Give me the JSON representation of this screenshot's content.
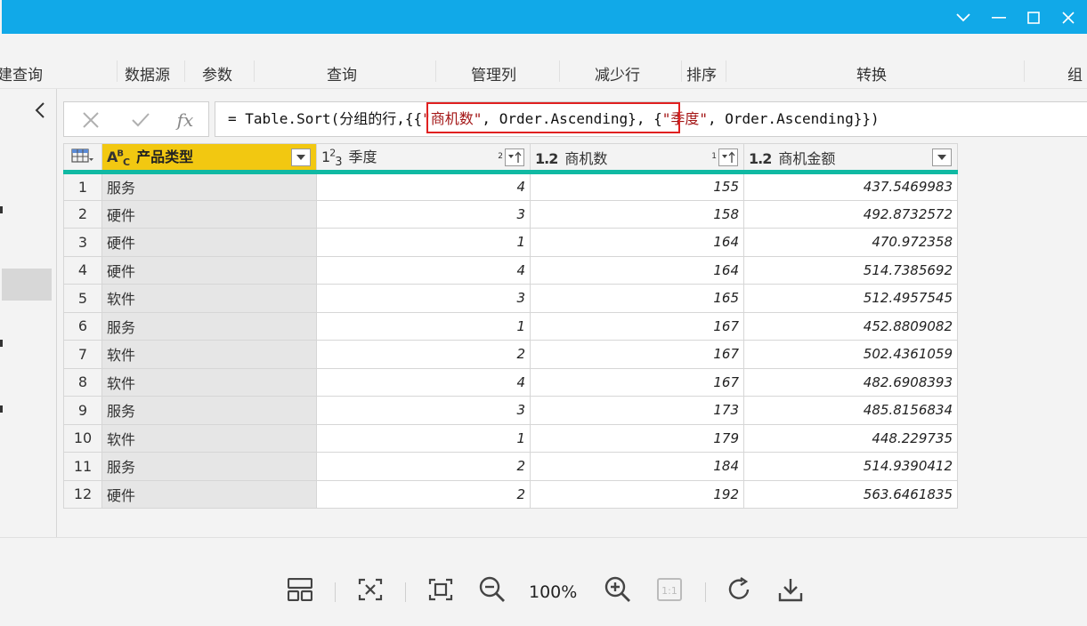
{
  "ribbon": {
    "groups": [
      "建查询",
      "数据源",
      "参数",
      "查询",
      "管理列",
      "减少行",
      "排序",
      "转换",
      "组"
    ]
  },
  "formula_bar": {
    "cancel_icon": "close-icon",
    "commit_icon": "check-icon",
    "fx_label": "fx",
    "prefix": "= Table.Sort(分组的行,{{",
    "str1": "\"商机数\"",
    "mid1": ", Order.Ascending}, {",
    "str2": "\"季度\"",
    "suffix": ", Order.Ascending}})"
  },
  "table": {
    "columns": [
      {
        "type_icon": "ABC",
        "name": "产品类型",
        "sort_index": ""
      },
      {
        "type_icon": "123",
        "name": "季度",
        "sort_index": "2"
      },
      {
        "type_icon": "1.2",
        "name": "商机数",
        "sort_index": "1"
      },
      {
        "type_icon": "1.2",
        "name": "商机金额",
        "sort_index": ""
      }
    ],
    "rows": [
      [
        "1",
        "服务",
        "4",
        "155",
        "437.5469983"
      ],
      [
        "2",
        "硬件",
        "3",
        "158",
        "492.8732572"
      ],
      [
        "3",
        "硬件",
        "1",
        "164",
        "470.972358"
      ],
      [
        "4",
        "硬件",
        "4",
        "164",
        "514.7385692"
      ],
      [
        "5",
        "软件",
        "3",
        "165",
        "512.4957545"
      ],
      [
        "6",
        "服务",
        "1",
        "167",
        "452.8809082"
      ],
      [
        "7",
        "软件",
        "2",
        "167",
        "502.4361059"
      ],
      [
        "8",
        "软件",
        "4",
        "167",
        "482.6908393"
      ],
      [
        "9",
        "服务",
        "3",
        "173",
        "485.8156834"
      ],
      [
        "10",
        "软件",
        "1",
        "179",
        "448.229735"
      ],
      [
        "11",
        "服务",
        "2",
        "184",
        "514.9390412"
      ],
      [
        "12",
        "硬件",
        "2",
        "192",
        "563.6461835"
      ]
    ]
  },
  "status": {
    "zoom": "100%"
  },
  "colors": {
    "title_bar": "#11a9e8",
    "selected_header": "#f2c811",
    "header_underline": "#10b9a3",
    "highlight_box": "#e02020"
  }
}
